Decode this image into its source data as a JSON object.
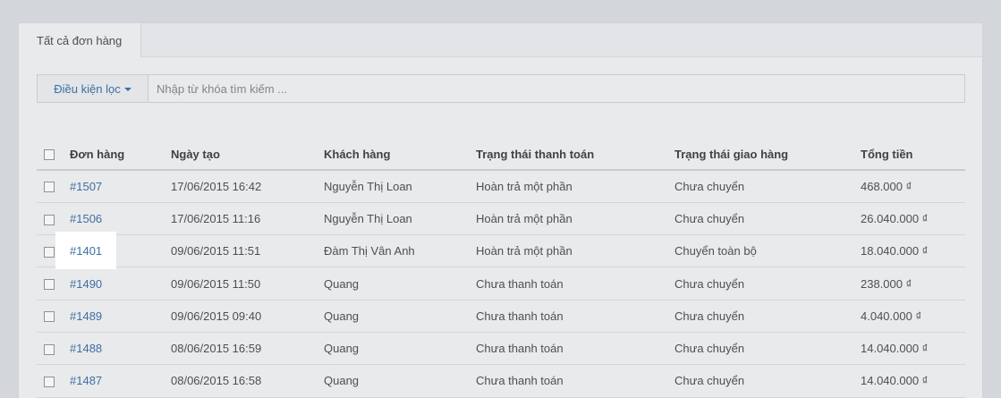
{
  "tab": {
    "label": "Tất cả đơn hàng"
  },
  "filter": {
    "button_label": "Điều kiện lọc",
    "search_placeholder": "Nhập từ khóa tìm kiếm ..."
  },
  "table": {
    "headers": {
      "order": "Đơn hàng",
      "date": "Ngày tạo",
      "customer": "Khách hàng",
      "payment_status": "Trạng thái thanh toán",
      "shipping_status": "Trạng thái giao hàng",
      "total": "Tổng tiền"
    },
    "rows": [
      {
        "order": "#1507",
        "date": "17/06/2015 16:42",
        "customer": "Nguyễn Thị Loan",
        "payment": "Hoàn trả một phần",
        "shipping": "Chưa chuyển",
        "total": "468.000 ₫"
      },
      {
        "order": "#1506",
        "date": "17/06/2015 11:16",
        "customer": "Nguyễn Thị Loan",
        "payment": "Hoàn trả một phần",
        "shipping": "Chưa chuyển",
        "total": "26.040.000 ₫"
      },
      {
        "order": "#1401",
        "date": "09/06/2015 11:51",
        "customer": "Đàm Thị Vân Anh",
        "payment": "Hoàn trả một phần",
        "shipping": "Chuyển toàn bộ",
        "total": "18.040.000 ₫"
      },
      {
        "order": "#1490",
        "date": "09/06/2015 11:50",
        "customer": "Quang",
        "payment": "Chưa thanh toán",
        "shipping": "Chưa chuyển",
        "total": "238.000 ₫"
      },
      {
        "order": "#1489",
        "date": "09/06/2015 09:40",
        "customer": "Quang",
        "payment": "Chưa thanh toán",
        "shipping": "Chưa chuyển",
        "total": "4.040.000 ₫"
      },
      {
        "order": "#1488",
        "date": "08/06/2015 16:59",
        "customer": "Quang",
        "payment": "Chưa thanh toán",
        "shipping": "Chưa chuyển",
        "total": "14.040.000 ₫"
      },
      {
        "order": "#1487",
        "date": "08/06/2015 16:58",
        "customer": "Quang",
        "payment": "Chưa thanh toán",
        "shipping": "Chưa chuyển",
        "total": "14.040.000 ₫"
      }
    ]
  },
  "highlighted_order": "#1401",
  "colors": {
    "link": "#3d6fa3",
    "overlay": "#d3d6da",
    "highlight": "#ffffff"
  }
}
